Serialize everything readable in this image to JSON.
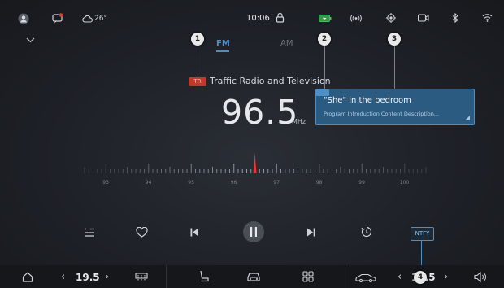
{
  "status_bar": {
    "weather_temp": "26°",
    "time": "10:06",
    "icons": [
      "avatar-icon",
      "message-heart-icon",
      "cloud-icon",
      "lock-icon",
      "battery-icon",
      "broadcast-icon",
      "location-icon",
      "camera-icon",
      "bluetooth-icon",
      "wifi-icon"
    ]
  },
  "tabs": {
    "fm_label": "FM",
    "am_label": "AM",
    "active": "FM"
  },
  "station": {
    "badge": "TR",
    "name": "Traffic Radio and Television",
    "frequency": "96.5",
    "unit": "MHz"
  },
  "program": {
    "title": "\"She\" in the bedroom",
    "description": "Program Introduction Content Description..."
  },
  "markers": [
    "1",
    "2",
    "3",
    "4"
  ],
  "tuner": {
    "labels": [
      "93",
      "94",
      "95",
      "96",
      "97",
      "98",
      "99",
      "100"
    ],
    "current": 96.5,
    "range": [
      92.5,
      100.5
    ]
  },
  "controls": {
    "icons": [
      "playlist-icon",
      "heart-icon",
      "previous-icon",
      "pause-icon",
      "next-icon",
      "timer-icon"
    ],
    "notify_label": "NTFY"
  },
  "bottom_bar": {
    "left_temp": "19.5",
    "right_temp": "19.5",
    "icons": [
      "home-icon",
      "rear-defrost-icon",
      "seat-icon",
      "car-icon",
      "apps-grid-icon",
      "car-side-icon",
      "volume-icon"
    ]
  },
  "colors": {
    "accent": "#4b8fc7",
    "card_bg": "#2c5b82",
    "needle": "#e03a3a",
    "background": "#1d2026"
  }
}
